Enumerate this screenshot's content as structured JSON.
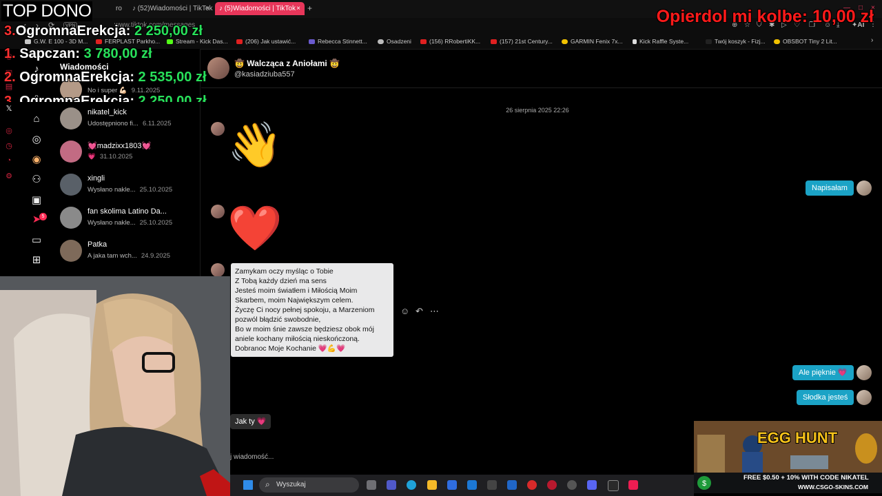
{
  "overlay": {
    "stream_title": "TOP DONO",
    "leaderboard": [
      {
        "rank": "3.",
        "name": "OgromnaErekcja:",
        "amount": "2 250,00 zł"
      },
      {
        "rank": "1.",
        "name": "Sapczan:",
        "amount": "3 780,00 zł"
      },
      {
        "rank": "2.",
        "name": "OgromnaErekcja:",
        "amount": "2 535,00 zł"
      },
      {
        "rank": "3.",
        "name": "OgromnaErekcja:",
        "amount": "2 250,00 zł"
      }
    ],
    "goal_text": "Opierdol mi kolbe:",
    "goal_amount": "10,00 zł",
    "ad": {
      "title": "EGG HUNT",
      "line1": "FREE $0.50 + 10% WITH CODE NIKATEL",
      "line2": "WWW.CSGO-SKINS.COM"
    }
  },
  "browser": {
    "tabs": [
      {
        "label": "(52)Wiadomości | TikTok",
        "active": false
      },
      {
        "label": "(5)Wiadomości | TikTok",
        "active": true
      }
    ],
    "url": "www.tiktok.com/messages",
    "vpn": "VPN",
    "bookmarks": [
      {
        "label": "G.W. E 100 - 3D M...",
        "color": "#c8c8c8"
      },
      {
        "label": "FERPLAST Parkho...",
        "color": "#e02020"
      },
      {
        "label": "Stream - Kick Das...",
        "color": "#53fc18"
      },
      {
        "label": "(206) Jak ustawić...",
        "color": "#e02020"
      },
      {
        "label": "Rebecca Stinnett...",
        "color": "#6a5acd"
      },
      {
        "label": "Osadzeni",
        "color": "#bbbbbb"
      },
      {
        "label": "(156) RRobertiKK...",
        "color": "#e02020"
      },
      {
        "label": "(157) 21st Century...",
        "color": "#e02020"
      },
      {
        "label": "GARMIN Fenix 7x...",
        "color": "#f2c200"
      },
      {
        "label": "Kick Raffle Syste...",
        "color": "#dddddd"
      },
      {
        "label": "Twój koszyk - Fizj...",
        "color": "#222222"
      },
      {
        "label": "OBSBOT Tiny 2 Lit...",
        "color": "#f2c200"
      }
    ]
  },
  "sidebar": {
    "title": "Wiadomości",
    "conversations": [
      {
        "name": "",
        "preview": "No i super 💪🏻",
        "date": "9.11.2025",
        "av": "#b49a87"
      },
      {
        "name": "nikatel_kick",
        "preview": "Udostępniono fi...",
        "date": "6.11.2025",
        "av": "#9a9088"
      },
      {
        "name": "💓madzixx1803💓",
        "preview": "💗",
        "date": "31.10.2025",
        "av": "#c26b83"
      },
      {
        "name": "xingli",
        "preview": "Wysłano nakle...",
        "date": "25.10.2025",
        "av": "#596068"
      },
      {
        "name": "fan skolima Latino Da...",
        "preview": "Wysłano nakle...",
        "date": "25.10.2025",
        "av": "#8a8a8a"
      },
      {
        "name": "Patka",
        "preview": "A jaka tam wch...",
        "date": "24.9.2025",
        "av": "#7e6a5a"
      }
    ],
    "nav_badge": "5"
  },
  "chat": {
    "header_name": "🤠 Walcząca z Aniołami 🤠",
    "header_user": "@kasiadziuba557",
    "date_separator": "26 sierpnia 2025 22:26",
    "sticker_wave": "👋",
    "sticker_heart": "❤️",
    "sent_1": "Napisałam",
    "poem_lines": [
      "Zamykam oczy myśląc o Tobie",
      "Z Tobą każdy dzień ma sens",
      "Jesteś moim światłem i Miłością  Moim",
      "Skarbem, moim Największym celem.",
      "Życzę Ci nocy pełnej spokoju, a Marzeniom",
      "pozwól błądzić swobodnie,",
      "Bo w moim śnie zawsze będziesz obok mój",
      "aniele kochany miłością nieskończoną.",
      "Dobranoc Moje Kochanie 💗💪💗"
    ],
    "sent_2": "Ale pięknie 💗",
    "sent_3": "Słodka jesteś",
    "received_last": "Jak ty 💗",
    "composer_placeholder": "j wiadomość..."
  },
  "taskbar": {
    "search_label": "Wyszukaj"
  }
}
